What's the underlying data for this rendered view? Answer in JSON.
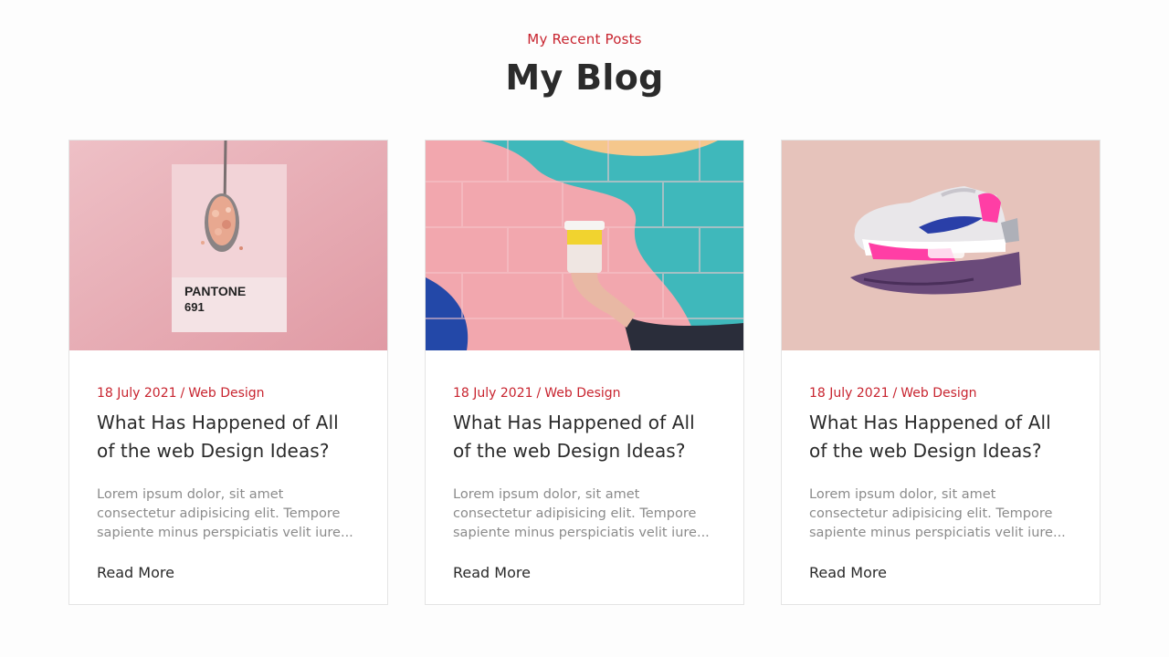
{
  "header": {
    "kicker": "My Recent Posts",
    "title": "My Blog"
  },
  "colors": {
    "accent": "#c8242f",
    "text": "#2a2a2a",
    "muted": "#8b8b8b",
    "border": "#e4e4e4"
  },
  "posts": [
    {
      "image_text_line1": "PANTONE",
      "image_text_line2": "691",
      "date": "18 July 2021",
      "separator": "/",
      "category": "Web Design",
      "title": "What Has Happened of All of the web Design Ideas?",
      "excerpt": "Lorem ipsum dolor, sit amet consectetur adipisicing elit. Tempore sapiente minus perspiciatis velit iure...",
      "read_more": "Read More"
    },
    {
      "date": "18 July 2021",
      "separator": "/",
      "category": "Web Design",
      "title": "What Has Happened of All of the web Design Ideas?",
      "excerpt": "Lorem ipsum dolor, sit amet consectetur adipisicing elit. Tempore sapiente minus perspiciatis velit iure...",
      "read_more": "Read More"
    },
    {
      "date": "18 July 2021",
      "separator": "/",
      "category": "Web Design",
      "title": "What Has Happened of All of the web Design Ideas?",
      "excerpt": "Lorem ipsum dolor, sit amet consectetur adipisicing elit. Tempore sapiente minus perspiciatis velit iure...",
      "read_more": "Read More"
    }
  ]
}
